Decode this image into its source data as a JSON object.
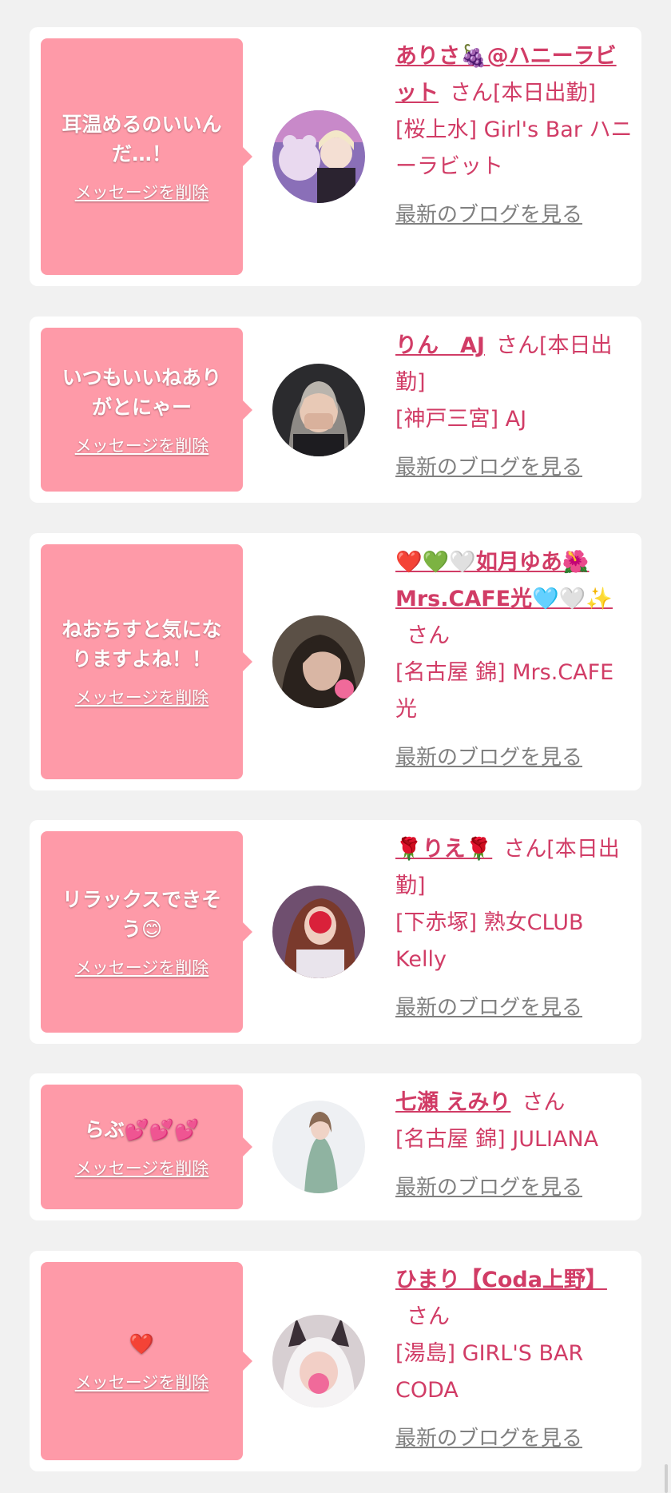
{
  "cards": [
    {
      "message": "耳温めるのいいんだ…！",
      "delete_label": "メッセージを削除",
      "name": "ありさ🍇@ハニーラビット",
      "honorific": "さん[本日出勤]",
      "shop": "[桜上水] Girl's Bar ハニーラビット",
      "blog_label": "最新のブログを見る"
    },
    {
      "message": "いつもいいねありがとにゃー",
      "delete_label": "メッセージを削除",
      "name": "りん　AJ",
      "honorific": "さん[本日出勤]",
      "shop": "[神戸三宮] AJ",
      "blog_label": "最新のブログを見る"
    },
    {
      "message": "ねおちすと気になりますよね！！",
      "delete_label": "メッセージを削除",
      "name": "❤️💚🤍如月ゆあ🌺Mrs.CAFE光🩵🤍✨",
      "honorific": "さん",
      "shop": "[名古屋 錦] Mrs.CAFE光",
      "blog_label": "最新のブログを見る"
    },
    {
      "message": "リラックスできそう😊",
      "delete_label": "メッセージを削除",
      "name": "🌹りえ🌹",
      "honorific": "さん[本日出勤]",
      "shop": "[下赤塚] 熟女CLUB Kelly",
      "blog_label": "最新のブログを見る"
    },
    {
      "message": "らぶ💕💕💕",
      "delete_label": "メッセージを削除",
      "name": "七瀬 えみり",
      "honorific": "さん",
      "shop": "[名古屋 錦] JULIANA",
      "blog_label": "最新のブログを見る"
    },
    {
      "message": "❤️",
      "delete_label": "メッセージを削除",
      "name": "ひまり【Coda上野】",
      "honorific": "さん",
      "shop": "[湯島] GIRL'S BAR CODA",
      "blog_label": "最新のブログを見る"
    }
  ],
  "colors": {
    "bubble": "#fe9aa8",
    "name_text": "#d13c66",
    "link_gray": "#808080",
    "background": "#f1f1f1"
  }
}
